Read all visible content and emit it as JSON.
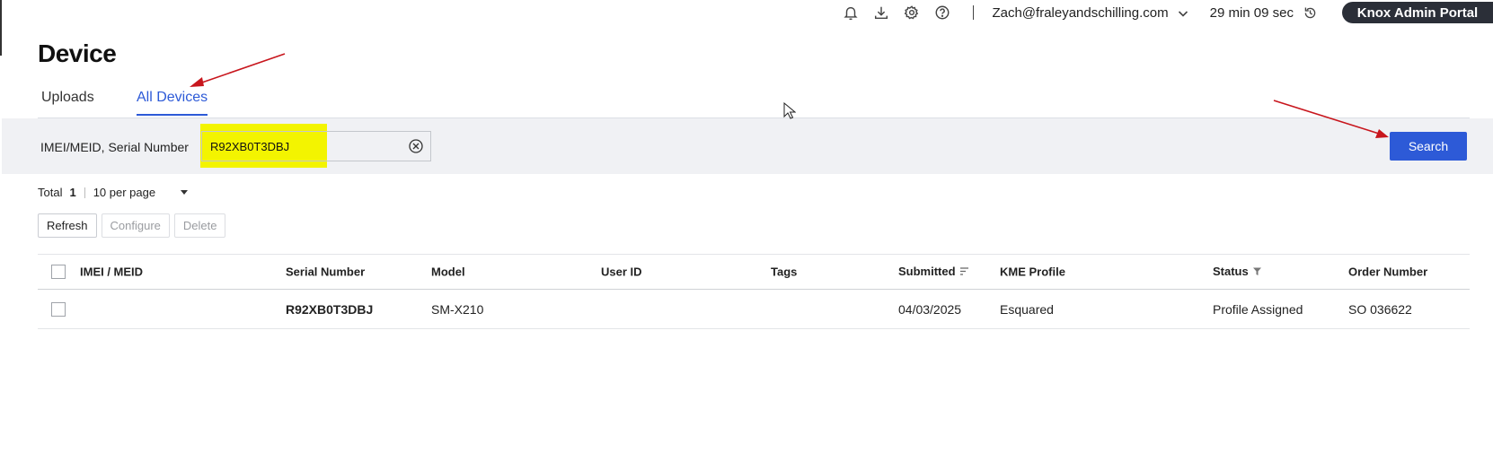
{
  "topbar": {
    "icons": [
      "bell-icon",
      "download-icon",
      "gear-icon",
      "help-icon"
    ],
    "user_email": "Zach@fraleyandschilling.com",
    "session_timer": "29 min 09 sec",
    "portal_label": "Knox Admin Portal"
  },
  "page": {
    "title": "Device"
  },
  "tabs": [
    {
      "label": "Uploads",
      "active": false
    },
    {
      "label": "All Devices",
      "active": true
    }
  ],
  "search": {
    "label": "IMEI/MEID, Serial Number",
    "value": "R92XB0T3DBJ",
    "button_label": "Search",
    "highlight_color": "#f3f400"
  },
  "summary": {
    "total_label": "Total",
    "total_count": "1",
    "per_page": "10 per page"
  },
  "actions": {
    "refresh": "Refresh",
    "configure": "Configure",
    "delete": "Delete"
  },
  "table": {
    "headers": {
      "imei": "IMEI / MEID",
      "serial": "Serial Number",
      "model": "Model",
      "user_id": "User ID",
      "tags": "Tags",
      "submitted": "Submitted",
      "kme_profile": "KME Profile",
      "status": "Status",
      "order_number": "Order Number"
    },
    "rows": [
      {
        "imei": "",
        "serial": "R92XB0T3DBJ",
        "model": "SM-X210",
        "user_id": "",
        "tags": "",
        "submitted": "04/03/2025",
        "kme_profile": "Esquared",
        "status": "Profile Assigned",
        "order_number": "SO 036622"
      }
    ]
  },
  "colors": {
    "accent": "#2d5ad7",
    "annotation_arrow": "#c8161d",
    "portal_bg": "#2b2f38"
  }
}
